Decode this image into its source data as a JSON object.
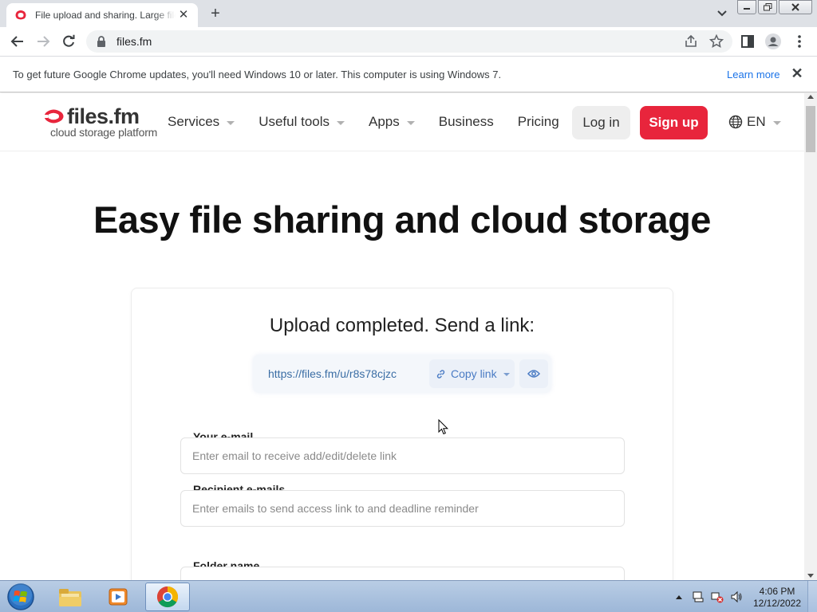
{
  "browser": {
    "tab_title": "File upload and sharing. Large files",
    "url": "files.fm",
    "infobar_message": "To get future Google Chrome updates, you'll need Windows 10 or later. This computer is using Windows 7.",
    "infobar_link": "Learn more"
  },
  "site": {
    "logo_text": "files.fm",
    "logo_tagline": "cloud storage platform",
    "nav": [
      {
        "label": "Services",
        "has_dropdown": true
      },
      {
        "label": "Useful tools",
        "has_dropdown": true
      },
      {
        "label": "Apps",
        "has_dropdown": true
      },
      {
        "label": "Business",
        "has_dropdown": false
      },
      {
        "label": "Pricing",
        "has_dropdown": false
      }
    ],
    "login_label": "Log in",
    "signup_label": "Sign up",
    "language": "EN"
  },
  "hero": {
    "title": "Easy file sharing and cloud storage"
  },
  "upload": {
    "heading": "Upload completed. Send a link:",
    "link": "https://files.fm/u/r8s78cjzc",
    "copy_label": "Copy link"
  },
  "form": {
    "email_label": "Your e-mail",
    "email_placeholder": "Enter email to receive add/edit/delete link",
    "recipients_label": "Recipient e-mails",
    "recipients_placeholder": "Enter emails to send access link to and deadline reminder",
    "folder_label": "Folder name"
  },
  "taskbar": {
    "time": "4:06 PM",
    "date": "12/12/2022"
  },
  "colors": {
    "brand_red": "#e8253c",
    "link_blue": "#3b6ea5",
    "chrome_link": "#1a73e8"
  }
}
